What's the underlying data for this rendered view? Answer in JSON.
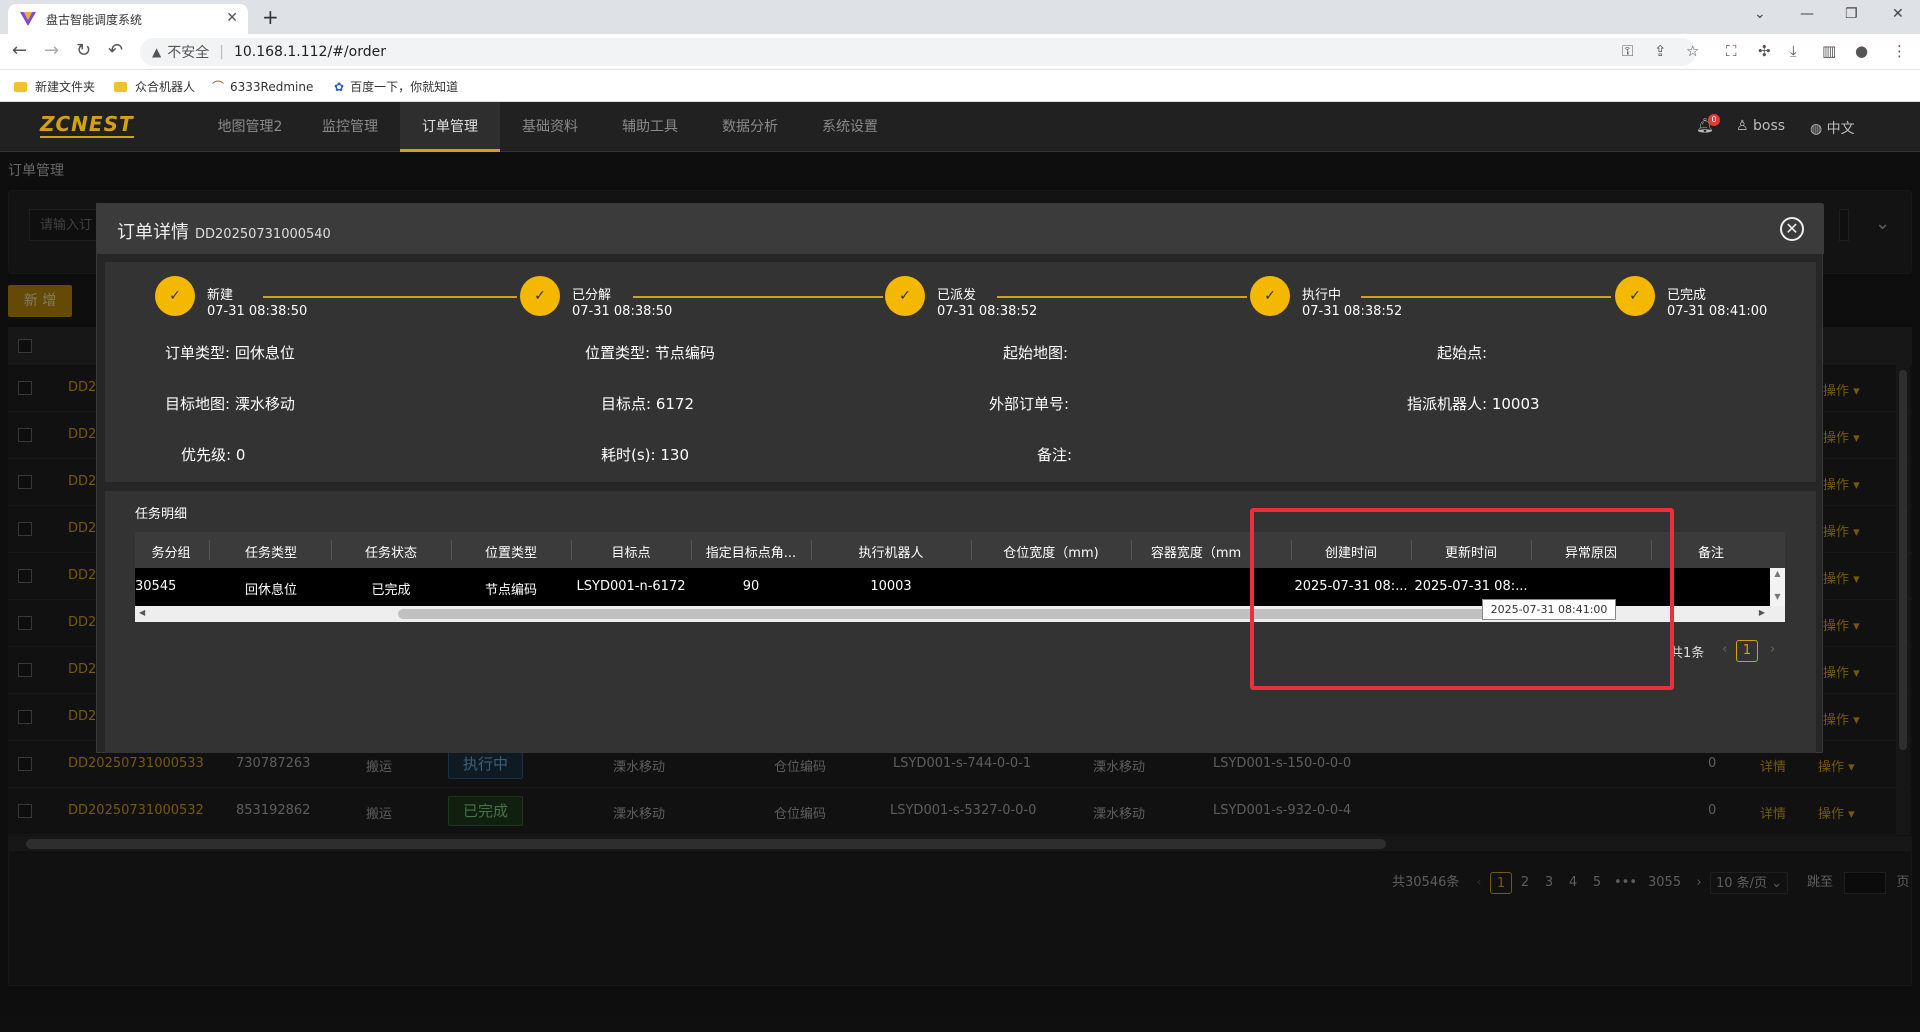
{
  "browser": {
    "tab_title": "盘古智能调度系统",
    "url_insecure": "不安全",
    "url": "10.168.1.112/#/order",
    "bookmarks": [
      "新建文件夹",
      "众合机器人",
      "6333Redmine",
      "百度一下，你就知道"
    ]
  },
  "app": {
    "brand": "ZCNEST",
    "nav": [
      "地图管理2",
      "监控管理",
      "订单管理",
      "基础资料",
      "辅助工具",
      "数据分析",
      "系统设置"
    ],
    "active_nav": "订单管理",
    "user": "boss",
    "language": "中文",
    "notification_count": "0"
  },
  "page": {
    "breadcrumb": "订单管理",
    "search_placeholder": "请输入订",
    "add_button": "新 增",
    "rows": [
      {
        "order": "DD2"
      },
      {
        "order": "DD2"
      },
      {
        "order": "DD2"
      },
      {
        "order": "DD2"
      },
      {
        "order": "DD2"
      },
      {
        "order": "DD2"
      },
      {
        "order": "DD2"
      },
      {
        "order": "DD2"
      },
      {
        "order": "DD20250731000533",
        "ext": "730787263",
        "type": "搬运",
        "status": "执行中",
        "map": "溧水移动",
        "pos_type": "仓位编码",
        "start": "LSYD001-s-744-0-0-1",
        "target_map": "溧水移动",
        "target": "LSYD001-s-150-0-0-0",
        "priority": "0",
        "detail": "详情",
        "op": "操作"
      },
      {
        "order": "DD20250731000532",
        "ext": "853192862",
        "type": "搬运",
        "status": "已完成",
        "map": "溧水移动",
        "pos_type": "仓位编码",
        "start": "LSYD001-s-5327-0-0-0",
        "target_map": "溧水移动",
        "target": "LSYD001-s-932-0-0-4",
        "priority": "0",
        "detail": "详情",
        "op": "操作"
      }
    ],
    "row_op_label": "操作",
    "pager": {
      "total": "共30546条",
      "pages": [
        "1",
        "2",
        "3",
        "4",
        "5",
        "•••",
        "3055"
      ],
      "current": "1",
      "page_size": "10 条/页",
      "goto_label": "跳至",
      "page_suffix": "页"
    }
  },
  "modal": {
    "title": "订单详情",
    "order_no": "DD20250731000540",
    "steps": [
      {
        "label": "新建",
        "time": "07-31 08:38:50"
      },
      {
        "label": "已分解",
        "time": "07-31 08:38:50"
      },
      {
        "label": "已派发",
        "time": "07-31 08:38:52"
      },
      {
        "label": "执行中",
        "time": "07-31 08:38:52"
      },
      {
        "label": "已完成",
        "time": "07-31 08:41:00"
      }
    ],
    "info": {
      "order_type_k": "订单类型:",
      "order_type_v": "回休息位",
      "pos_type_k": "位置类型:",
      "pos_type_v": "节点编码",
      "start_map_k": "起始地图:",
      "start_map_v": "",
      "start_point_k": "起始点:",
      "start_point_v": "",
      "target_map_k": "目标地图:",
      "target_map_v": "溧水移动",
      "target_point_k": "目标点:",
      "target_point_v": "6172",
      "ext_order_k": "外部订单号:",
      "ext_order_v": "",
      "robot_k": "指派机器人:",
      "robot_v": "10003",
      "priority_k": "优先级:",
      "priority_v": "0",
      "duration_k": "耗时(s):",
      "duration_v": "130",
      "remark_k": "备注:",
      "remark_v": ""
    },
    "task_section_title": "任务明细",
    "task_columns": [
      "务分组",
      "任务类型",
      "任务状态",
      "位置类型",
      "目标点",
      "指定目标点角...",
      "执行机器人",
      "仓位宽度（mm)",
      "容器宽度（mm",
      "创建时间",
      "更新时间",
      "异常原因",
      "备注"
    ],
    "task_row": [
      "30545",
      "回休息位",
      "已完成",
      "节点编码",
      "LSYD001-n-6172",
      "90",
      "10003",
      "",
      "",
      "2025-07-31 08:...",
      "2025-07-31 08:...",
      "",
      ""
    ],
    "tooltip": "2025-07-31 08:41:00",
    "pager_total": "共1条",
    "pager_current": "1"
  }
}
